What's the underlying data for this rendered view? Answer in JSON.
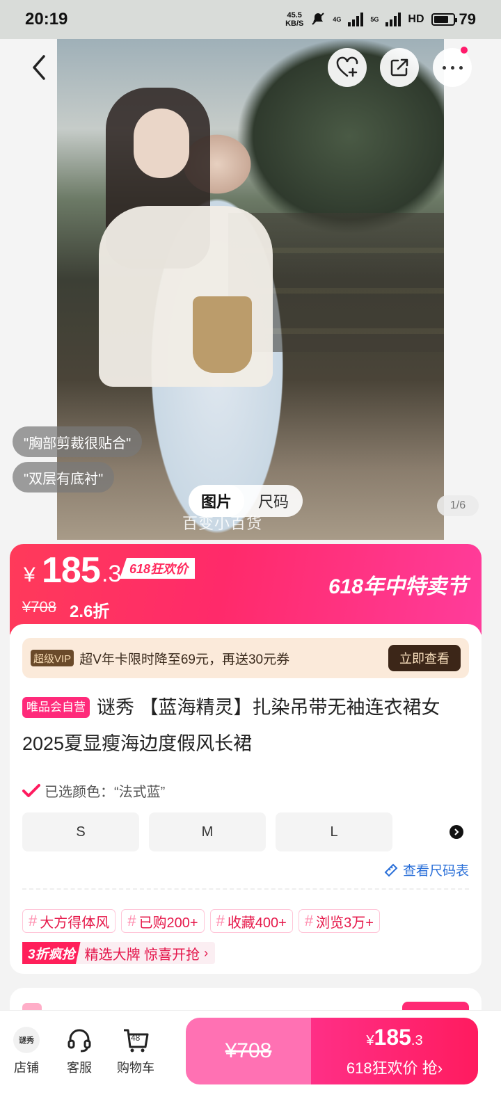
{
  "status_bar": {
    "time": "20:19",
    "net_speed_value": "45.5",
    "net_speed_unit": "KB/S",
    "network_labels": [
      "4G",
      "5G",
      "HD"
    ],
    "battery": "79"
  },
  "hero": {
    "review_tags": [
      "\"胸部剪裁很贴合\"",
      "\"双层有底衬\""
    ],
    "toggle": {
      "active": "图片",
      "inactive": "尺码"
    },
    "counter": "1/6",
    "watermark": "百变小百货"
  },
  "price_banner": {
    "currency": "¥",
    "price_int": "185",
    "price_dec": ".3",
    "event_price_label": "618狂欢价",
    "original_price": "¥708",
    "discount": "2.6折",
    "festival_label": "618年中特卖节",
    "colors": {
      "start": "#ff3a5a",
      "end": "#ff3c9b"
    }
  },
  "product": {
    "vip_badge": "超级VIP",
    "vip_text": "超V年卡限时降至69元，再送30元券",
    "vip_button": "立即查看",
    "self_operated_badge": "唯品会自营",
    "title": "谜秀 【蓝海精灵】扎染吊带无袖连衣裙女2025夏显瘦海边度假风长裙",
    "selected_color": "已选颜色：“法式蓝”",
    "sizes": [
      "S",
      "M",
      "L"
    ],
    "size_chart_link": "查看尺码表",
    "tags": [
      "大方得体风",
      "已购200+",
      "收藏400+",
      "浏览3万+"
    ],
    "promo_label": "3折疯抢",
    "promo_text": "精选大牌 惊喜开抢",
    "promo_arrow": "›"
  },
  "bottom_bar": {
    "store_logo_text": "谜秀",
    "store": "店铺",
    "service": "客服",
    "cart": "购物车",
    "cart_count": "48",
    "cta_original": "¥708",
    "cta_currency": "¥",
    "cta_price_int": "185",
    "cta_price_dec": ".3",
    "cta_label": "618狂欢价 抢",
    "cta_arrow": "›",
    "colors": {
      "accent": "#ff1b5f",
      "light": "#ff71b3"
    }
  }
}
